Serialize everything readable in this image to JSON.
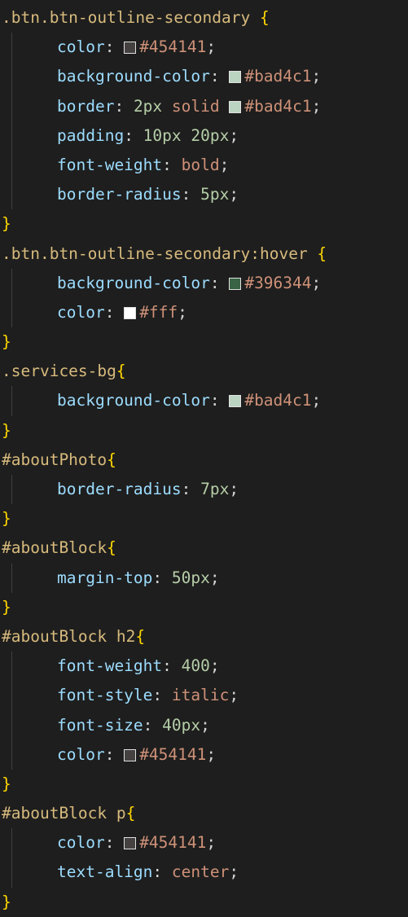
{
  "lines": [
    {
      "kind": "open",
      "sel": ".btn.btn-outline-secondary ",
      "brace": "{"
    },
    {
      "kind": "decl",
      "prop": "color",
      "parts": [
        {
          "t": "swatch",
          "color": "#454141"
        },
        {
          "t": "val",
          "v": "#454141"
        }
      ]
    },
    {
      "kind": "decl",
      "prop": "background-color",
      "parts": [
        {
          "t": "swatch",
          "color": "#bad4c1"
        },
        {
          "t": "val",
          "v": "#bad4c1"
        }
      ]
    },
    {
      "kind": "decl",
      "prop": "border",
      "parts": [
        {
          "t": "num",
          "v": "2px"
        },
        {
          "t": "sp",
          "v": " "
        },
        {
          "t": "val",
          "v": "solid"
        },
        {
          "t": "sp",
          "v": " "
        },
        {
          "t": "swatch",
          "color": "#bad4c1"
        },
        {
          "t": "val",
          "v": "#bad4c1"
        }
      ]
    },
    {
      "kind": "decl",
      "prop": "padding",
      "parts": [
        {
          "t": "num",
          "v": "10px"
        },
        {
          "t": "sp",
          "v": " "
        },
        {
          "t": "num",
          "v": "20px"
        }
      ]
    },
    {
      "kind": "decl",
      "prop": "font-weight",
      "parts": [
        {
          "t": "val",
          "v": "bold"
        }
      ]
    },
    {
      "kind": "decl",
      "prop": "border-radius",
      "parts": [
        {
          "t": "num",
          "v": "5px"
        }
      ]
    },
    {
      "kind": "close",
      "brace": "}"
    },
    {
      "kind": "open",
      "sel": ".btn.btn-outline-secondary:hover ",
      "brace": "{"
    },
    {
      "kind": "decl",
      "prop": "background-color",
      "parts": [
        {
          "t": "swatch",
          "color": "#396344"
        },
        {
          "t": "val",
          "v": "#396344"
        }
      ]
    },
    {
      "kind": "decl",
      "prop": "color",
      "parts": [
        {
          "t": "swatch",
          "color": "#ffffff"
        },
        {
          "t": "val",
          "v": "#fff"
        }
      ]
    },
    {
      "kind": "close",
      "brace": "}"
    },
    {
      "kind": "open",
      "sel": ".services-bg",
      "brace": "{"
    },
    {
      "kind": "decl",
      "prop": "background-color",
      "parts": [
        {
          "t": "swatch",
          "color": "#bad4c1"
        },
        {
          "t": "val",
          "v": "#bad4c1"
        }
      ]
    },
    {
      "kind": "close",
      "brace": "}"
    },
    {
      "kind": "open",
      "sel": "#aboutPhoto",
      "brace": "{"
    },
    {
      "kind": "decl",
      "prop": "border-radius",
      "parts": [
        {
          "t": "num",
          "v": "7px"
        }
      ]
    },
    {
      "kind": "close",
      "brace": "}"
    },
    {
      "kind": "open",
      "sel": "#aboutBlock",
      "brace": "{"
    },
    {
      "kind": "decl",
      "prop": "margin-top",
      "parts": [
        {
          "t": "num",
          "v": "50px"
        }
      ]
    },
    {
      "kind": "close",
      "brace": "}"
    },
    {
      "kind": "open",
      "sel": "#aboutBlock h2",
      "brace": "{"
    },
    {
      "kind": "decl",
      "prop": "font-weight",
      "parts": [
        {
          "t": "num",
          "v": "400"
        }
      ]
    },
    {
      "kind": "decl",
      "prop": "font-style",
      "parts": [
        {
          "t": "val",
          "v": "italic"
        }
      ]
    },
    {
      "kind": "decl",
      "prop": "font-size",
      "parts": [
        {
          "t": "num",
          "v": "40px"
        }
      ]
    },
    {
      "kind": "decl",
      "prop": "color",
      "parts": [
        {
          "t": "swatch",
          "color": "#454141"
        },
        {
          "t": "val",
          "v": "#454141"
        }
      ]
    },
    {
      "kind": "close",
      "brace": "}"
    },
    {
      "kind": "open",
      "sel": "#aboutBlock p",
      "brace": "{"
    },
    {
      "kind": "decl",
      "prop": "color",
      "parts": [
        {
          "t": "swatch",
          "color": "#454141"
        },
        {
          "t": "val",
          "v": "#454141"
        }
      ]
    },
    {
      "kind": "decl",
      "prop": "text-align",
      "parts": [
        {
          "t": "val",
          "v": "center"
        }
      ]
    },
    {
      "kind": "close",
      "brace": "}"
    }
  ]
}
